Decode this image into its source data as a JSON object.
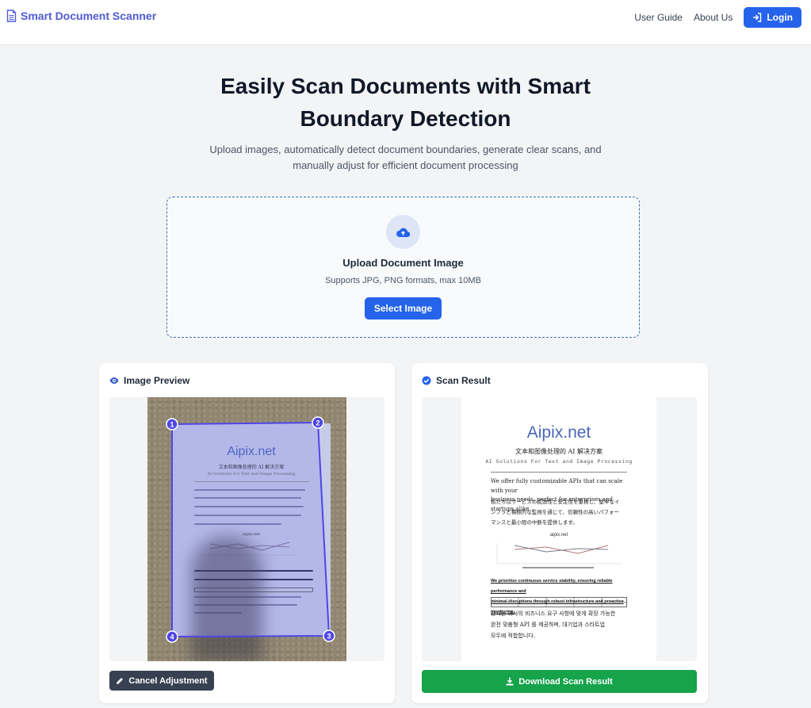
{
  "brand": {
    "title": "Smart Document Scanner",
    "icon": "document-icon",
    "color": "#4f5bd5"
  },
  "nav": {
    "user_guide": "User Guide",
    "about": "About Us",
    "login": "Login",
    "login_color": "#2563eb"
  },
  "hero": {
    "title_line1": "Easily Scan Documents with Smart",
    "title_line2": "Boundary Detection",
    "subtitle_line1": "Upload images, automatically detect document boundaries, generate clear scans, and",
    "subtitle_line2": "manually adjust for efficient document processing"
  },
  "upload": {
    "title": "Upload Document Image",
    "hint": "Supports JPG, PNG formats, max 10MB",
    "button": "Select Image",
    "icon": "cloud-upload-icon"
  },
  "preview": {
    "header": "Image Preview",
    "icon": "eye-icon",
    "corners": [
      "1",
      "2",
      "3",
      "4"
    ],
    "cancel_button": "Cancel Adjustment",
    "doc_logo": "Aipix.net",
    "doc_subtitle_cn": "文本和图像处理的 AI 解决方案",
    "doc_subtitle_en": "AI Solutions For Text and Image Processing",
    "doc_chart_title": "aipix.net"
  },
  "result": {
    "header": "Scan Result",
    "icon": "check-circle-icon",
    "download_button": "Download Scan Result",
    "download_color": "#16a34a",
    "doc_logo": "Aipix.net",
    "doc_subtitle_cn": "文本和图像处理的 AI 解决方案",
    "doc_subtitle_en": "AI Solutions For Text and Image Processing",
    "doc_en_line1": "We offer fully customizable APIs that can scale with your",
    "doc_en_line2": "business needs, perfect for enterprises and startups alike.",
    "doc_ja_line1": "私たちはサービスの拡張性と安定性を重視し、堅牢なイ",
    "doc_ja_line2": "ンフラと積極的な監視を通じて、信頼性の高いパフォー",
    "doc_ja_line3": "マンスと最小限の中断を提供します。",
    "doc_chart_title": "aipix.net",
    "doc_bold_line1": "We prioritize continuous service stability, ensuring reliable performance and",
    "doc_bold_line2": "minimal disruptions through robust infrastructure and proactive monitoring.",
    "doc_ko_line1": "당사는 귀사의 비즈니스 요구 사항에 맞게 확장 가능한",
    "doc_ko_line2": "완전 맞춤형 API 를 제공하며, 대기업과 스타트업",
    "doc_ko_line3": "모두에 적합합니다."
  }
}
